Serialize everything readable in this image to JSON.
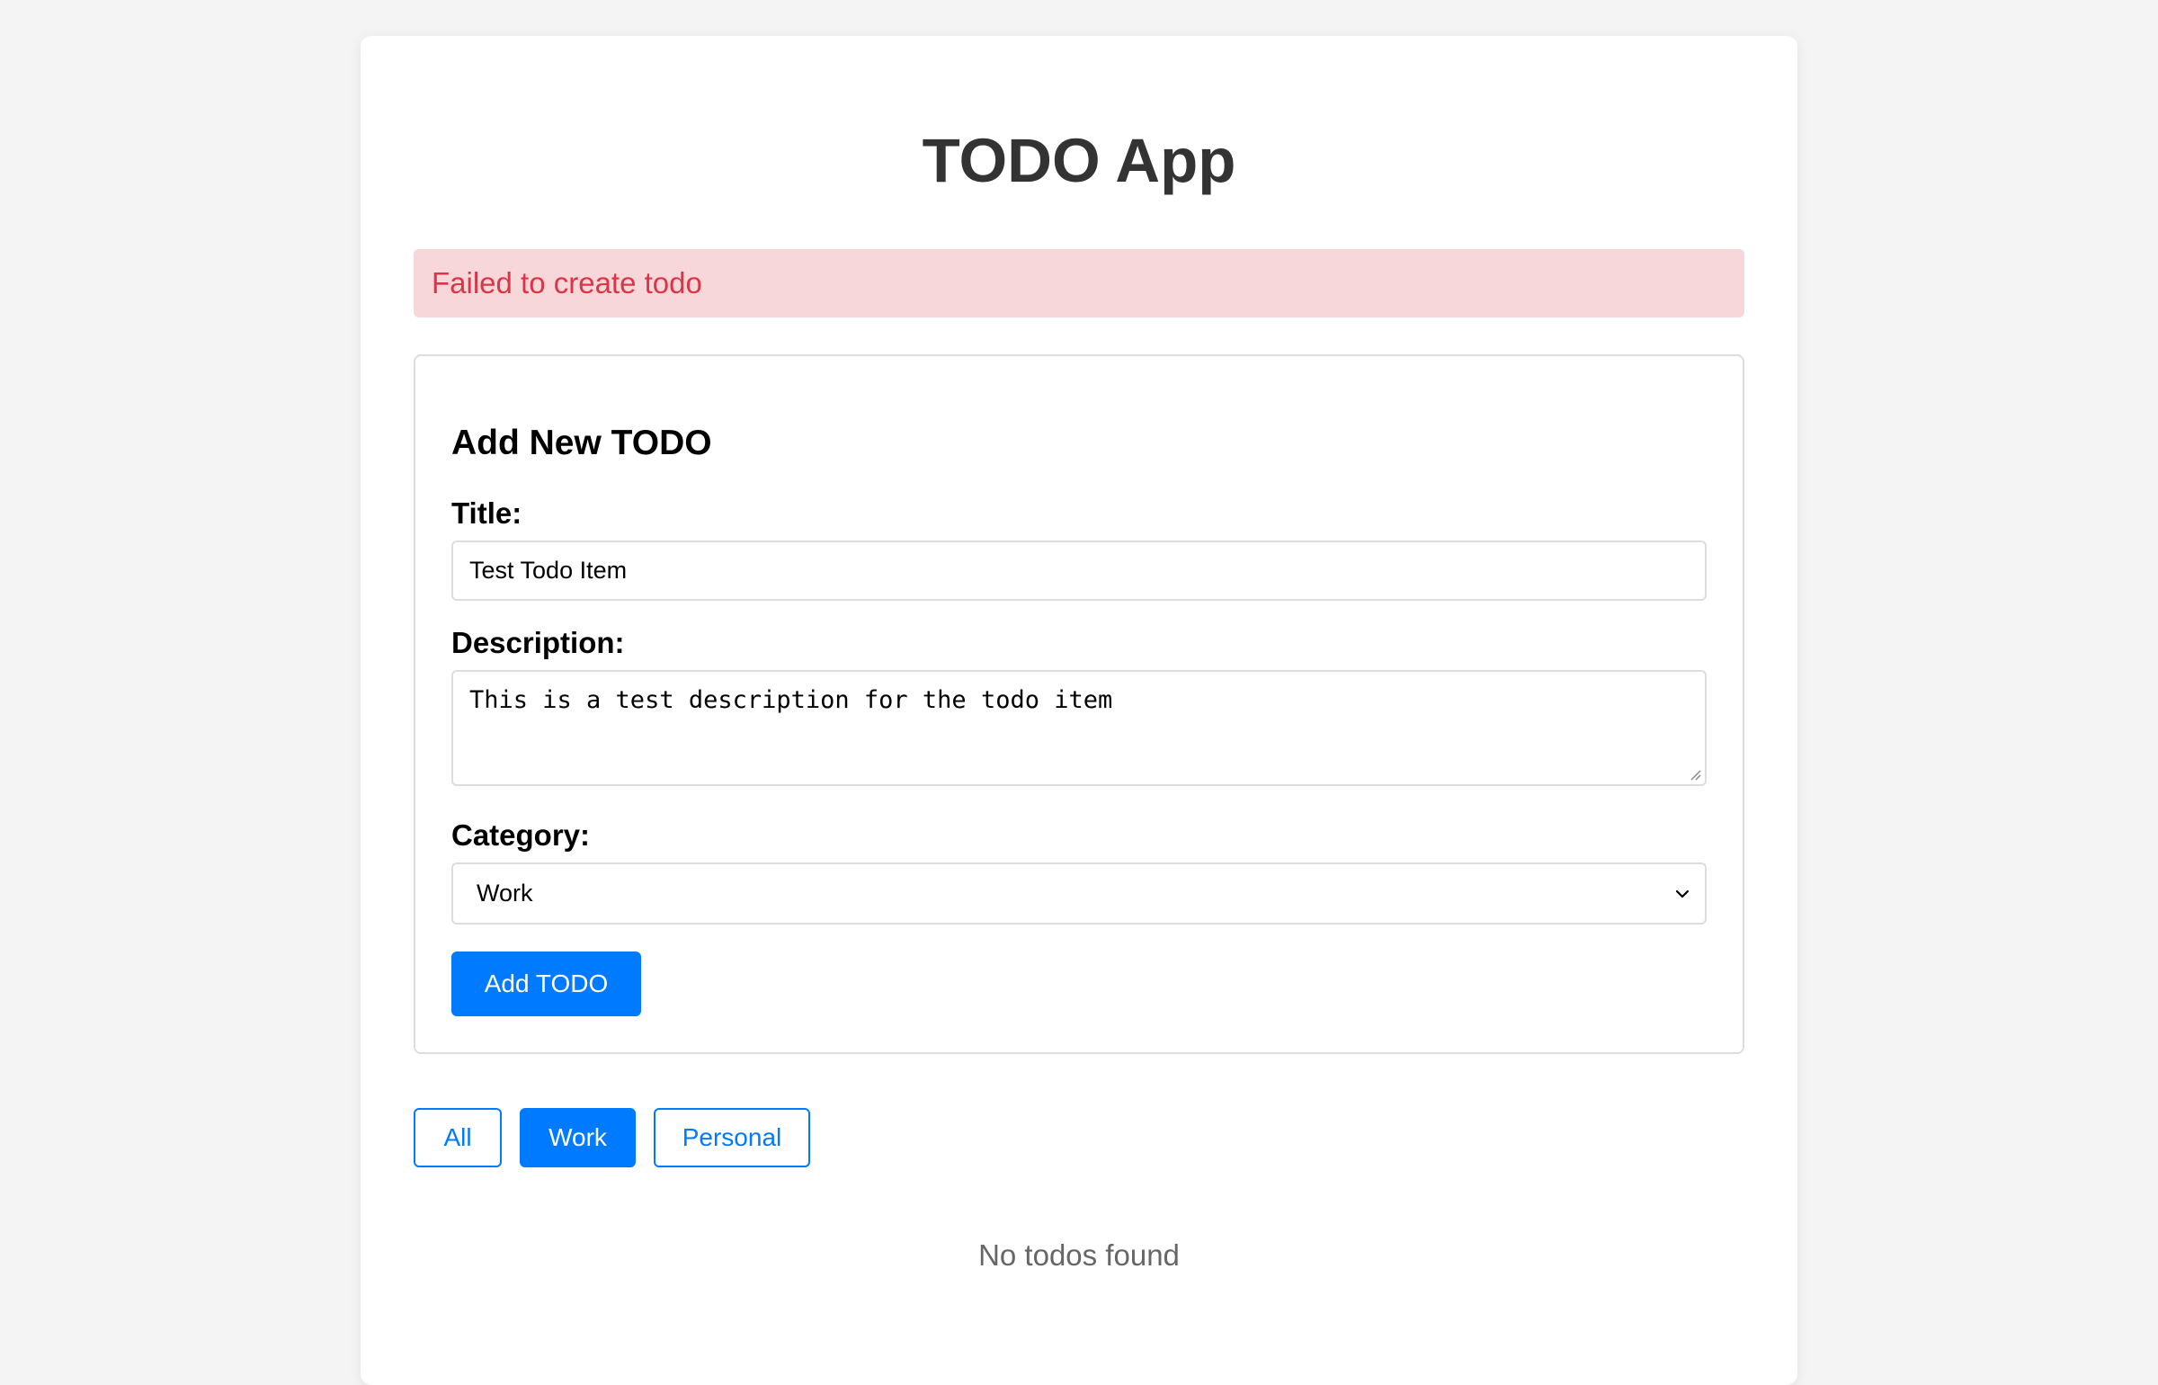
{
  "app": {
    "title": "TODO App"
  },
  "error": {
    "message": "Failed to create todo"
  },
  "form": {
    "heading": "Add New TODO",
    "title_label": "Title:",
    "title_value": "Test Todo Item",
    "description_label": "Description:",
    "description_value": "This is a test description for the todo item",
    "category_label": "Category:",
    "category_selected": "Work",
    "submit_label": "Add TODO"
  },
  "filters": {
    "items": [
      {
        "label": "All",
        "active": false
      },
      {
        "label": "Work",
        "active": true
      },
      {
        "label": "Personal",
        "active": false
      }
    ]
  },
  "list": {
    "empty_message": "No todos found"
  },
  "colors": {
    "accent": "#007bff",
    "error_bg": "#f8d7da",
    "error_text": "#dc3545",
    "page_bg": "#f4f4f4",
    "heading_text": "#333333",
    "muted_text": "#666666"
  }
}
